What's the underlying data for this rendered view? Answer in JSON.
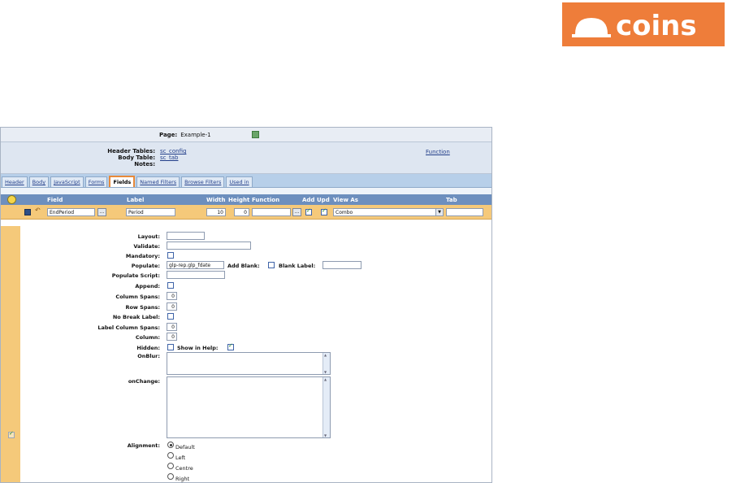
{
  "brand": {
    "logo_text": "coins",
    "color": "#ee7d3a"
  },
  "page": {
    "label": "Page:",
    "value": "Example-1"
  },
  "header": {
    "tables_label": "Header Tables:",
    "tables_value": "sc_config",
    "body_label": "Body Table:",
    "body_value": "sc_tab",
    "notes_label": "Notes:",
    "function_link": "Function"
  },
  "tabs": [
    "Header",
    "Body",
    "JavaScript",
    "Forms",
    "Fields",
    "Named Filters",
    "Browse Filters",
    "Used in"
  ],
  "active_tab": "Fields",
  "columns": {
    "field": "Field",
    "label": "Label",
    "width": "Width",
    "height": "Height",
    "function": "Function",
    "add": "Add",
    "upd": "Upd",
    "view_as": "View As",
    "tab": "Tab"
  },
  "row": {
    "field": "EndPeriod",
    "label": "Period",
    "width": "10",
    "height": "0",
    "function": "",
    "add": true,
    "upd": true,
    "view_as": "Combo",
    "tab": ""
  },
  "form": {
    "layout": "Layout:",
    "validate": "Validate:",
    "mandatory": "Mandatory:",
    "populate": "Populate:",
    "populate_value": "glp-rep.glp_fdate",
    "add_blank": "Add Blank:",
    "blank_label": "Blank Label:",
    "populate_script": "Populate Script:",
    "append": "Append:",
    "column_spans": "Column Spans:",
    "column_spans_value": "0",
    "row_spans": "Row Spans:",
    "row_spans_value": "0",
    "no_break_label": "No Break Label:",
    "label_column_spans": "Label Column Spans:",
    "label_column_spans_value": "0",
    "column": "Column:",
    "column_value": "0",
    "hidden": "Hidden:",
    "show_in_help": "Show in Help:",
    "onblur": "OnBlur:",
    "onchange": "onChange:",
    "alignment": "Alignment:",
    "alignment_options": [
      "Default",
      "Left",
      "Centre",
      "Right"
    ],
    "alignment_selected": "Default"
  }
}
